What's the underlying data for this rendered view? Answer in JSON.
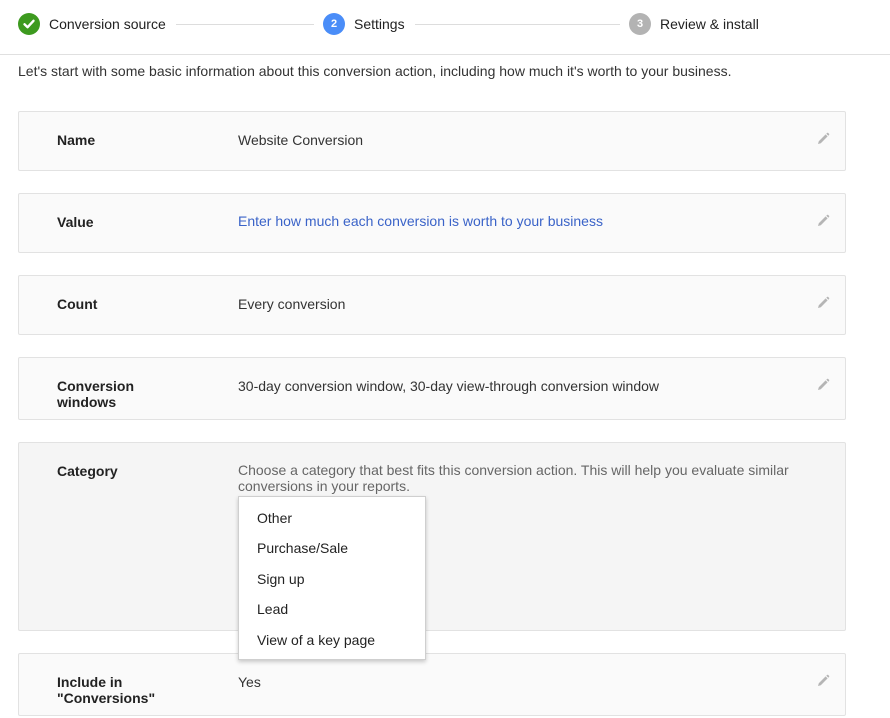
{
  "stepper": {
    "steps": [
      {
        "number": "1",
        "label": "Conversion source",
        "status": "complete",
        "icon": "check-icon"
      },
      {
        "number": "2",
        "label": "Settings",
        "status": "active"
      },
      {
        "number": "3",
        "label": "Review & install",
        "status": "pending"
      }
    ],
    "colors": {
      "complete": "#3d9a1f",
      "active": "#4a8df8",
      "pending": "#b3b3b3"
    }
  },
  "intro": "Let's start with some basic information about this conversion action, including how much it's worth to your business.",
  "settings": [
    {
      "label": "Name",
      "value": "Website Conversion",
      "icon": "pencil-icon"
    },
    {
      "label": "Value",
      "value": "Enter how much each conversion is worth to your business",
      "icon": "pencil-icon"
    },
    {
      "label": "Count",
      "value": "Every conversion",
      "icon": "pencil-icon"
    },
    {
      "label": "Conversion windows",
      "value": "30-day conversion window, 30-day view-through conversion window",
      "icon": "pencil-icon"
    },
    {
      "label": "Category",
      "value": "Choose a category that best fits this conversion action. This will help you evaluate similar conversions in your reports."
    },
    {
      "label": "Include in \"Conversions\"",
      "value": "Yes",
      "icon": "pencil-icon"
    }
  ],
  "category_dropdown": {
    "options": [
      "Other",
      "Purchase/Sale",
      "Sign up",
      "Lead",
      "View of a key page"
    ]
  },
  "colors": {
    "link": "#3a63c8",
    "edit_icon": "#b5b5b5"
  }
}
